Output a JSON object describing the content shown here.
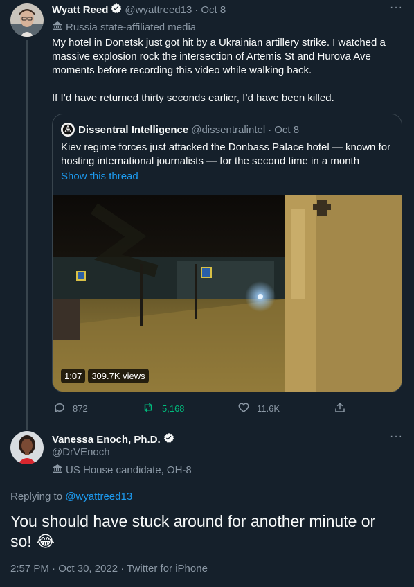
{
  "tweet": {
    "author_name": "Wyatt Reed",
    "handle": "@wyattreed13",
    "separator": "·",
    "date": "Oct 8",
    "label": "Russia state-affiliated media",
    "text_p1": "My hotel in Donetsk just got hit by a Ukrainian artillery strike. I watched a massive explosion rock the intersection of Artemis St and Hurova Ave moments before recording this video while walking back.",
    "text_p2": "If I’d have returned thirty seconds earlier, I’d have been killed.",
    "quote": {
      "author_name": "Dissentral Intelligence",
      "handle": "@dissentralintel",
      "separator": "·",
      "date": "Oct 8",
      "text": "Kiev regime forces just attacked the Donbass Palace hotel — known for hosting international journalists — for the second time in a month",
      "show_thread": "Show this thread",
      "video": {
        "duration": "1:07",
        "views": "309.7K views"
      }
    },
    "actions": {
      "replies": "872",
      "retweets": "5,168",
      "likes": "11.6K"
    }
  },
  "reply": {
    "author_name": "Vanessa Enoch, Ph.D.",
    "handle": "@DrVEnoch",
    "label": "US House candidate, OH-8",
    "replying_to_prefix": "Replying to",
    "replying_to_handle": "@wyattreed13",
    "text": "You should have stuck around for another minute or so!",
    "emoji": "😂",
    "time": "2:57 PM",
    "separator": "·",
    "date": "Oct 30, 2022",
    "source": "Twitter for iPhone"
  },
  "more_label": "···",
  "colors": {
    "background": "#15202b",
    "accent": "#1d9bf0",
    "retweet_green": "#00ba7c",
    "muted": "#8b98a5",
    "border": "#38444d"
  },
  "icons": [
    "verified-icon",
    "government-building-icon",
    "reply-icon",
    "retweet-icon",
    "like-icon",
    "share-icon",
    "more-icon"
  ]
}
